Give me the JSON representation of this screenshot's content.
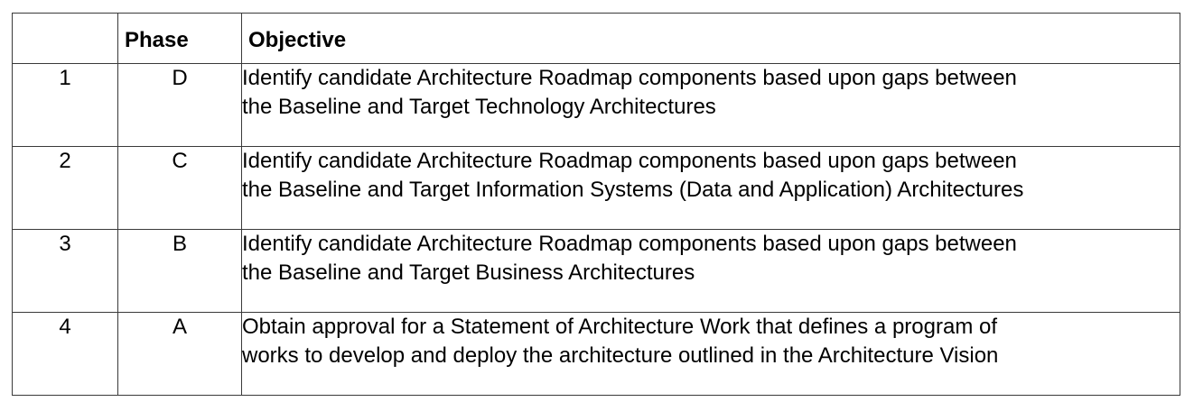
{
  "table": {
    "headers": {
      "number": "",
      "phase": "Phase",
      "objective": "Objective"
    },
    "rows": [
      {
        "number": "1",
        "phase": "D",
        "objective_line1": "Identify candidate Architecture Roadmap components based upon gaps between",
        "objective_line2": "the Baseline and Target Technology Architectures"
      },
      {
        "number": "2",
        "phase": "C",
        "objective_line1": "Identify candidate Architecture Roadmap components based upon gaps between",
        "objective_line2": "the Baseline and Target Information Systems (Data and Application) Architectures"
      },
      {
        "number": "3",
        "phase": "B",
        "objective_line1": "Identify candidate Architecture Roadmap components based upon gaps between",
        "objective_line2": "the Baseline and Target Business Architectures"
      },
      {
        "number": "4",
        "phase": "A",
        "objective_line1": "Obtain approval for a Statement of Architecture Work that defines a program of",
        "objective_line2": "works to develop and deploy the architecture outlined in the Architecture Vision"
      }
    ]
  }
}
